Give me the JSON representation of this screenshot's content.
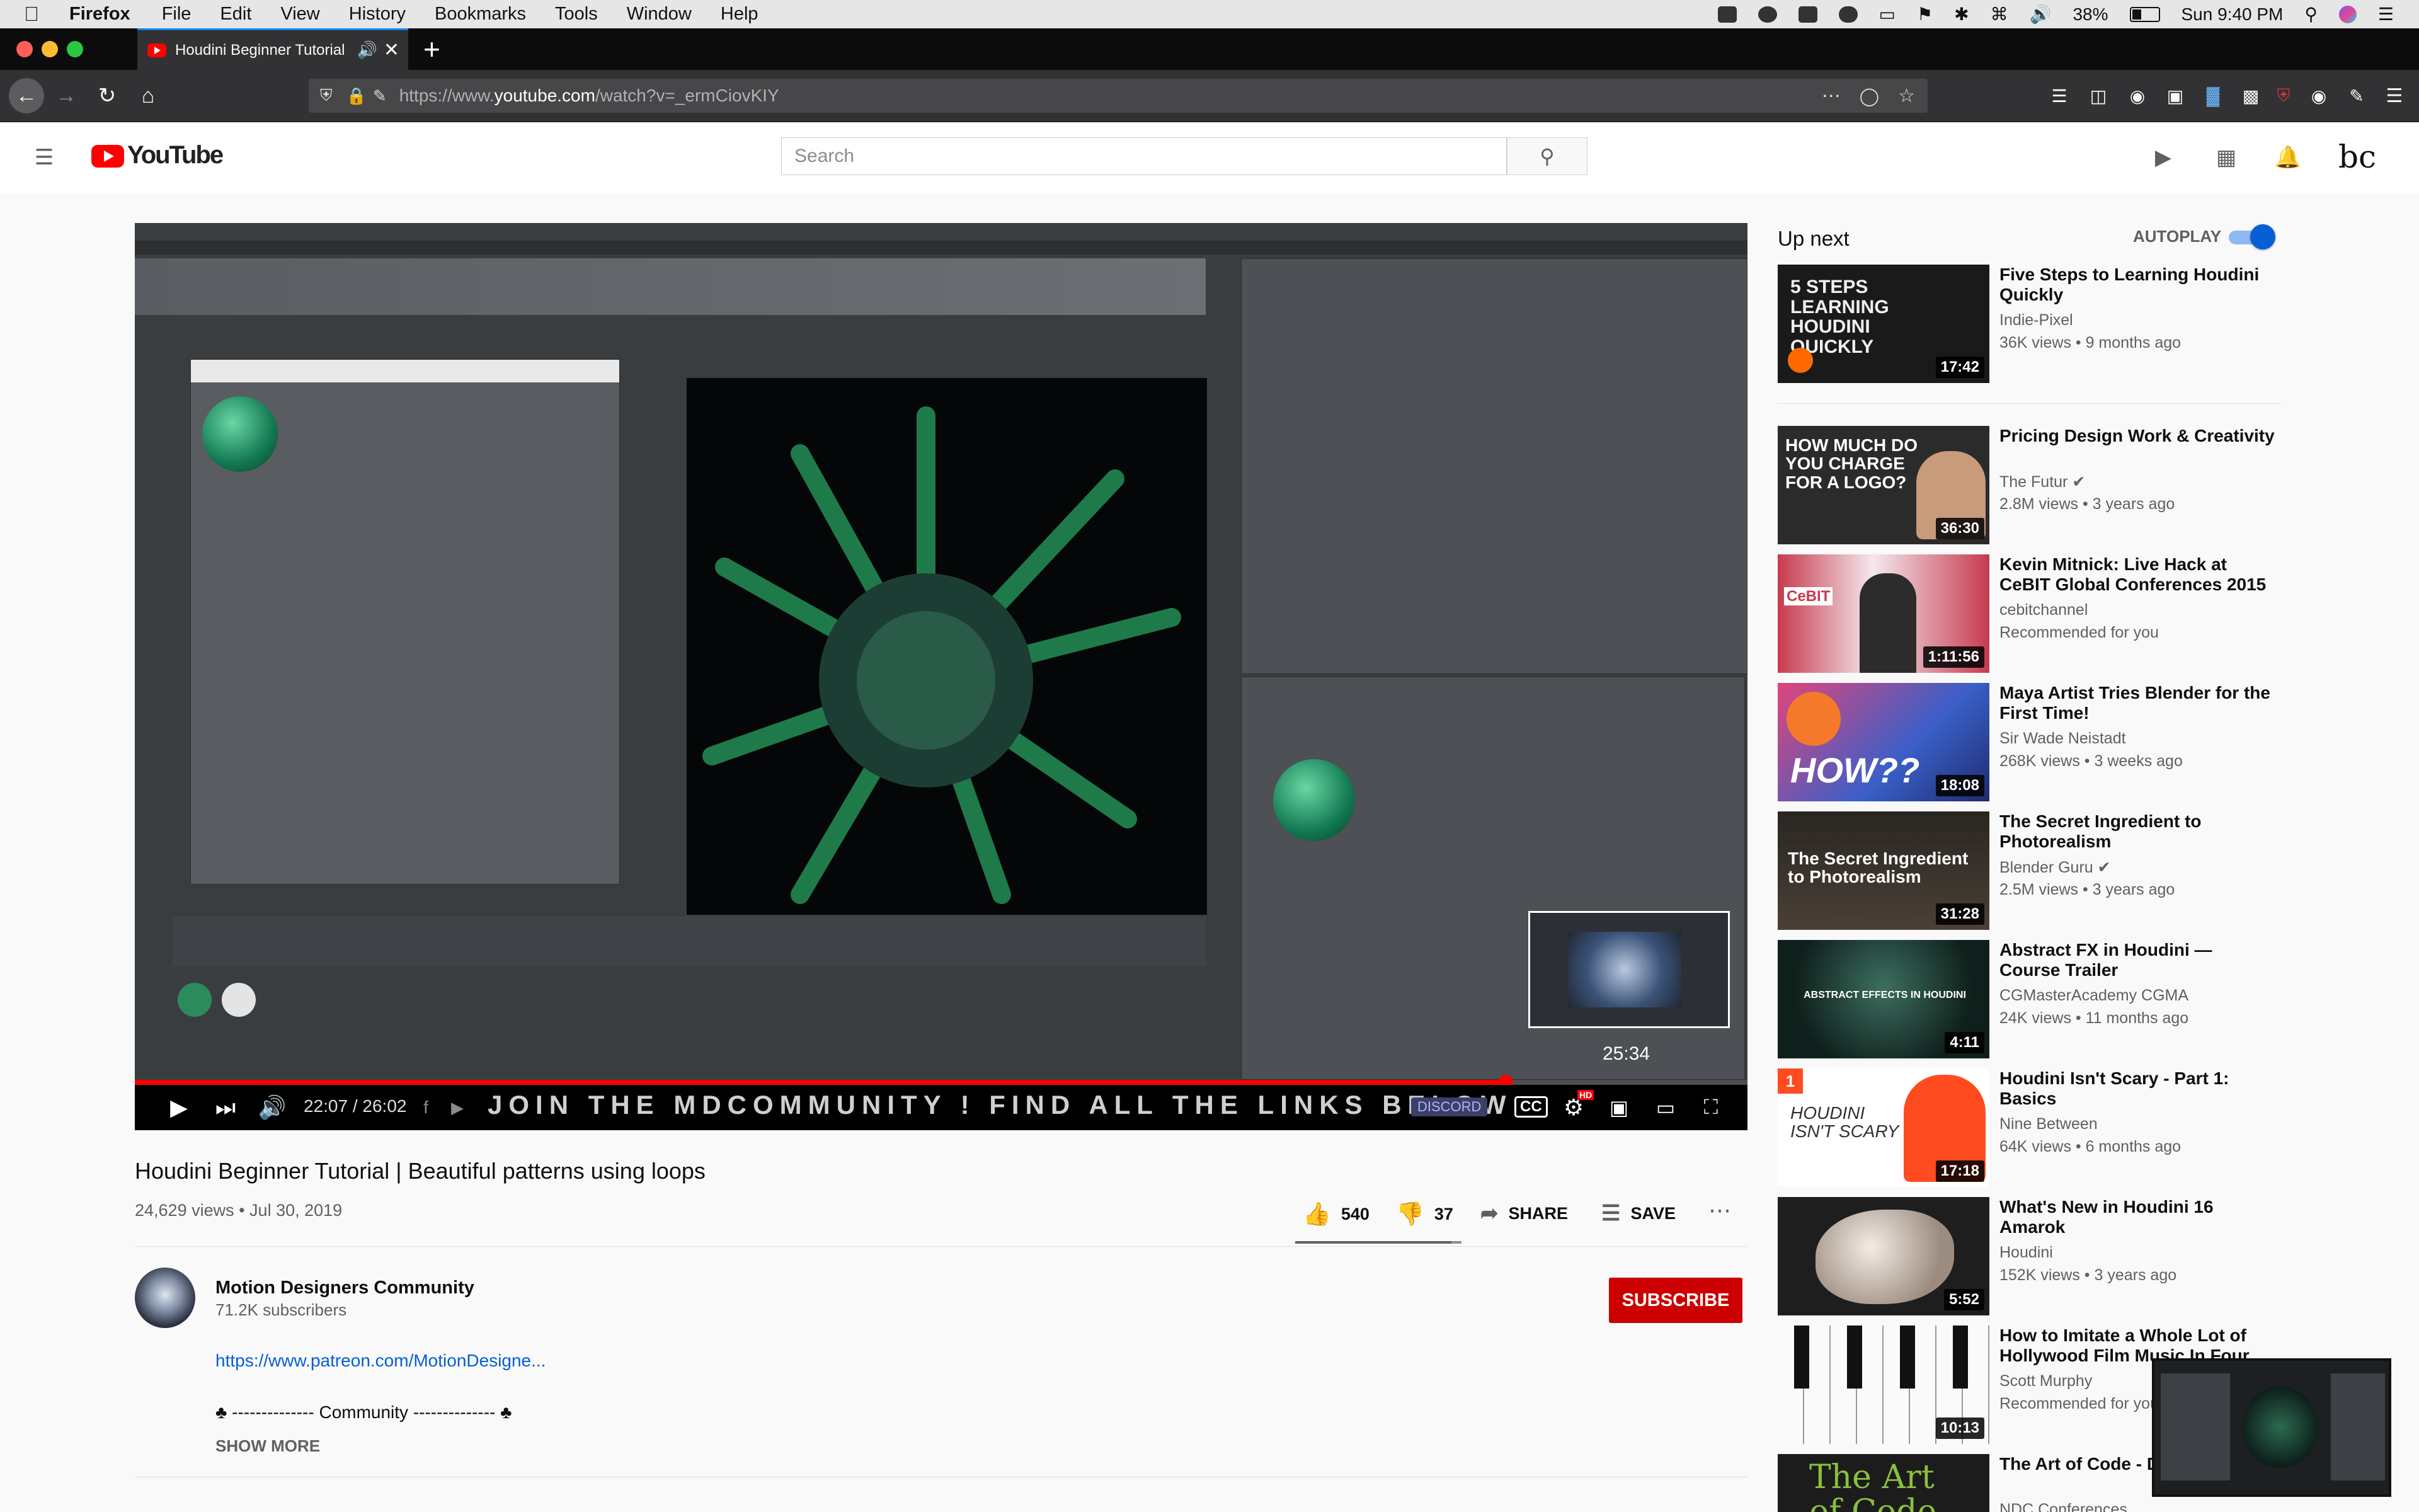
{
  "menubar": {
    "app": "Firefox",
    "items": [
      "File",
      "Edit",
      "View",
      "History",
      "Bookmarks",
      "Tools",
      "Window",
      "Help"
    ],
    "battery": "38%",
    "clock": "Sun 9:40 PM"
  },
  "browser": {
    "tab_title": "Houdini Beginner Tutorial | B",
    "url_prefix": "https://www.",
    "url_domain": "youtube.com",
    "url_path": "/watch?v=_ermCiovKIY",
    "new_tab": "+"
  },
  "youtube": {
    "logo_text": "YouTube",
    "search_placeholder": "Search",
    "account_initials": "bc"
  },
  "player": {
    "current_time": "22:07 / 26:02",
    "banner_text": "JOIN THE MDCOMMUNITY ! FIND ALL THE LINKS BELOW",
    "preview_time": "25:34",
    "progress_fraction": 0.85,
    "cc_label": "CC",
    "hd_label": "HD",
    "discord_label": "DISCORD"
  },
  "video": {
    "title": "Houdini Beginner Tutorial | Beautiful patterns using loops",
    "views_date": "24,629 views • Jul 30, 2019",
    "likes": "540",
    "dislikes": "37",
    "share_label": "SHARE",
    "save_label": "SAVE",
    "like_ratio": 0.94
  },
  "channel": {
    "name": "Motion Designers Community",
    "subscribers": "71.2K subscribers",
    "subscribe_label": "SUBSCRIBE"
  },
  "description": {
    "link": "https://www.patreon.com/MotionDesigne...",
    "community_line": "♣ -------------- Community -------------- ♣",
    "show_more": "SHOW MORE"
  },
  "sidebar": {
    "up_next": "Up next",
    "autoplay": "AUTOPLAY",
    "autoplay_on": true,
    "videos": [
      {
        "title": "Five Steps to Learning Houdini Quickly",
        "channel": "Indie-Pixel",
        "meta": "36K views • 9 months ago",
        "duration": "17:42",
        "thumb_text": "5 STEPS LEARNING HOUDINI QUICKLY",
        "color": "#1a1a1a"
      },
      {
        "title": "Pricing Design Work & Creativity",
        "channel": "The Futur",
        "meta": "2.8M views • 3 years ago",
        "duration": "36:30",
        "thumb_text": "HOW MUCH DO YOU CHARGE FOR A LOGO?",
        "color": "#2b2b2b"
      },
      {
        "title": "Kevin Mitnick: Live Hack at CeBIT Global Conferences 2015",
        "channel": "cebitchannel",
        "meta": "Recommended for you",
        "duration": "1:11:56",
        "thumb_text": "CeBIT",
        "color": "#b63244"
      },
      {
        "title": "Maya Artist Tries Blender for the First Time!",
        "channel": "Sir Wade Neistadt",
        "meta": "268K views • 3 weeks ago",
        "duration": "18:08",
        "thumb_text": "HOW??",
        "color": "#3a5fc8"
      },
      {
        "title": "The Secret Ingredient to Photorealism",
        "channel": "Blender Guru",
        "meta": "2.5M views • 3 years ago",
        "duration": "31:28",
        "thumb_text": "The Secret Ingredient to Photorealism",
        "color": "#3b3630"
      },
      {
        "title": "Abstract FX in Houdini — Course Trailer",
        "channel": "CGMasterAcademy CGMA",
        "meta": "24K views • 11 months ago",
        "duration": "4:11",
        "thumb_text": "ABSTRACT EFFECTS IN HOUDINI",
        "color": "#1f3a33"
      },
      {
        "title": "Houdini Isn't Scary - Part 1: Basics",
        "channel": "Nine Between",
        "meta": "64K views • 6 months ago",
        "duration": "17:18",
        "thumb_text": "HOUDINI ISN'T SCARY",
        "color": "#ffffff"
      },
      {
        "title": "What's New in Houdini 16 Amarok",
        "channel": "Houdini",
        "meta": "152K views • 3 years ago",
        "duration": "5:52",
        "thumb_text": "",
        "color": "#222222"
      },
      {
        "title": "How to Imitate a Whole Lot of Hollywood Film Music In Four",
        "channel": "Scott Murphy",
        "meta": "Recommended for you",
        "duration": "10:13",
        "thumb_text": "",
        "color": "#f2f2f2"
      },
      {
        "title": "The Art of Code - D",
        "channel": "NDC Conferences",
        "meta": "",
        "duration": "",
        "thumb_text": "The Art of Code",
        "color": "#1c1c1c"
      }
    ]
  }
}
